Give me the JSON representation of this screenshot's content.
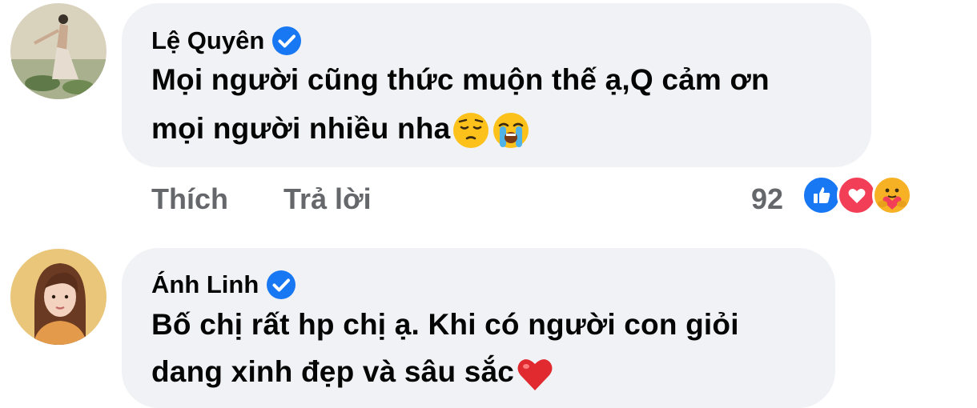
{
  "comments": [
    {
      "author": "Lệ Quyên",
      "text_line1": "Mọi người cũng thức muộn thế ạ,Q cảm ơn",
      "text_line2": "mọi người nhiều nha",
      "inline_emojis": [
        "pensive-face-emoji",
        "loudly-crying-face-emoji"
      ],
      "like_label": "Thích",
      "reply_label": "Trả lời",
      "reaction_count": "92",
      "reactions": [
        "like-reaction-icon",
        "love-reaction-icon",
        "care-reaction-icon"
      ],
      "verified": true
    },
    {
      "author": "Ánh Linh",
      "text_line1": "Bố chị rất hp chị ạ. Khi có người con giỏi",
      "text_line2": "dang xinh đẹp và sâu sắc",
      "inline_emojis": [
        "red-heart-emoji"
      ],
      "verified": true
    }
  ],
  "colors": {
    "bubble": "#f0f2f5",
    "text": "#050505",
    "secondary_text": "#65676b",
    "verified_blue": "#1877f2",
    "like_blue": "#1877f2",
    "love_red": "#f33e58",
    "care_yellow": "#f7b125"
  }
}
